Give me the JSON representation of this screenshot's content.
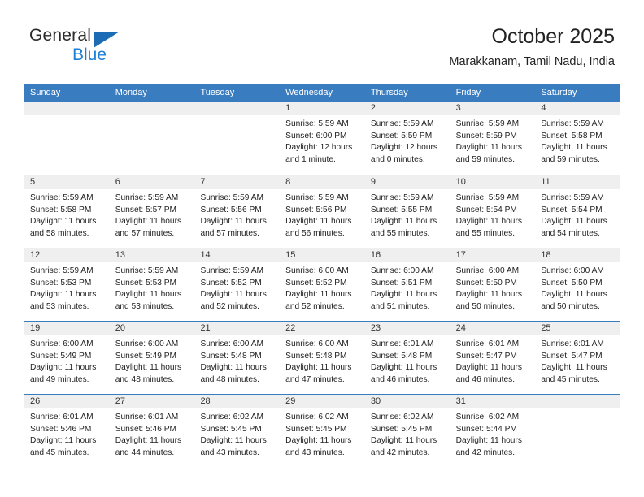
{
  "logo": {
    "top_text": "General",
    "bottom_text": "Blue",
    "triangle_icon": "triangle-icon",
    "accent_dark_blue": "#1b6cb5",
    "accent_blue": "#1f7fd4"
  },
  "header": {
    "title": "October 2025",
    "subtitle": "Marakkanam, Tamil Nadu, India"
  },
  "colors": {
    "header_band": "#3a7cc0",
    "cell_head": "#efefef",
    "text": "#222222"
  },
  "weekdays": [
    "Sunday",
    "Monday",
    "Tuesday",
    "Wednesday",
    "Thursday",
    "Friday",
    "Saturday"
  ],
  "weeks": [
    [
      {
        "day": "",
        "empty": true
      },
      {
        "day": "",
        "empty": true
      },
      {
        "day": "",
        "empty": true
      },
      {
        "day": "1",
        "sunrise": "Sunrise: 5:59 AM",
        "sunset": "Sunset: 6:00 PM",
        "daylight_1": "Daylight: 12 hours",
        "daylight_2": "and 1 minute."
      },
      {
        "day": "2",
        "sunrise": "Sunrise: 5:59 AM",
        "sunset": "Sunset: 5:59 PM",
        "daylight_1": "Daylight: 12 hours",
        "daylight_2": "and 0 minutes."
      },
      {
        "day": "3",
        "sunrise": "Sunrise: 5:59 AM",
        "sunset": "Sunset: 5:59 PM",
        "daylight_1": "Daylight: 11 hours",
        "daylight_2": "and 59 minutes."
      },
      {
        "day": "4",
        "sunrise": "Sunrise: 5:59 AM",
        "sunset": "Sunset: 5:58 PM",
        "daylight_1": "Daylight: 11 hours",
        "daylight_2": "and 59 minutes."
      }
    ],
    [
      {
        "day": "5",
        "sunrise": "Sunrise: 5:59 AM",
        "sunset": "Sunset: 5:58 PM",
        "daylight_1": "Daylight: 11 hours",
        "daylight_2": "and 58 minutes."
      },
      {
        "day": "6",
        "sunrise": "Sunrise: 5:59 AM",
        "sunset": "Sunset: 5:57 PM",
        "daylight_1": "Daylight: 11 hours",
        "daylight_2": "and 57 minutes."
      },
      {
        "day": "7",
        "sunrise": "Sunrise: 5:59 AM",
        "sunset": "Sunset: 5:56 PM",
        "daylight_1": "Daylight: 11 hours",
        "daylight_2": "and 57 minutes."
      },
      {
        "day": "8",
        "sunrise": "Sunrise: 5:59 AM",
        "sunset": "Sunset: 5:56 PM",
        "daylight_1": "Daylight: 11 hours",
        "daylight_2": "and 56 minutes."
      },
      {
        "day": "9",
        "sunrise": "Sunrise: 5:59 AM",
        "sunset": "Sunset: 5:55 PM",
        "daylight_1": "Daylight: 11 hours",
        "daylight_2": "and 55 minutes."
      },
      {
        "day": "10",
        "sunrise": "Sunrise: 5:59 AM",
        "sunset": "Sunset: 5:54 PM",
        "daylight_1": "Daylight: 11 hours",
        "daylight_2": "and 55 minutes."
      },
      {
        "day": "11",
        "sunrise": "Sunrise: 5:59 AM",
        "sunset": "Sunset: 5:54 PM",
        "daylight_1": "Daylight: 11 hours",
        "daylight_2": "and 54 minutes."
      }
    ],
    [
      {
        "day": "12",
        "sunrise": "Sunrise: 5:59 AM",
        "sunset": "Sunset: 5:53 PM",
        "daylight_1": "Daylight: 11 hours",
        "daylight_2": "and 53 minutes."
      },
      {
        "day": "13",
        "sunrise": "Sunrise: 5:59 AM",
        "sunset": "Sunset: 5:53 PM",
        "daylight_1": "Daylight: 11 hours",
        "daylight_2": "and 53 minutes."
      },
      {
        "day": "14",
        "sunrise": "Sunrise: 5:59 AM",
        "sunset": "Sunset: 5:52 PM",
        "daylight_1": "Daylight: 11 hours",
        "daylight_2": "and 52 minutes."
      },
      {
        "day": "15",
        "sunrise": "Sunrise: 6:00 AM",
        "sunset": "Sunset: 5:52 PM",
        "daylight_1": "Daylight: 11 hours",
        "daylight_2": "and 52 minutes."
      },
      {
        "day": "16",
        "sunrise": "Sunrise: 6:00 AM",
        "sunset": "Sunset: 5:51 PM",
        "daylight_1": "Daylight: 11 hours",
        "daylight_2": "and 51 minutes."
      },
      {
        "day": "17",
        "sunrise": "Sunrise: 6:00 AM",
        "sunset": "Sunset: 5:50 PM",
        "daylight_1": "Daylight: 11 hours",
        "daylight_2": "and 50 minutes."
      },
      {
        "day": "18",
        "sunrise": "Sunrise: 6:00 AM",
        "sunset": "Sunset: 5:50 PM",
        "daylight_1": "Daylight: 11 hours",
        "daylight_2": "and 50 minutes."
      }
    ],
    [
      {
        "day": "19",
        "sunrise": "Sunrise: 6:00 AM",
        "sunset": "Sunset: 5:49 PM",
        "daylight_1": "Daylight: 11 hours",
        "daylight_2": "and 49 minutes."
      },
      {
        "day": "20",
        "sunrise": "Sunrise: 6:00 AM",
        "sunset": "Sunset: 5:49 PM",
        "daylight_1": "Daylight: 11 hours",
        "daylight_2": "and 48 minutes."
      },
      {
        "day": "21",
        "sunrise": "Sunrise: 6:00 AM",
        "sunset": "Sunset: 5:48 PM",
        "daylight_1": "Daylight: 11 hours",
        "daylight_2": "and 48 minutes."
      },
      {
        "day": "22",
        "sunrise": "Sunrise: 6:00 AM",
        "sunset": "Sunset: 5:48 PM",
        "daylight_1": "Daylight: 11 hours",
        "daylight_2": "and 47 minutes."
      },
      {
        "day": "23",
        "sunrise": "Sunrise: 6:01 AM",
        "sunset": "Sunset: 5:48 PM",
        "daylight_1": "Daylight: 11 hours",
        "daylight_2": "and 46 minutes."
      },
      {
        "day": "24",
        "sunrise": "Sunrise: 6:01 AM",
        "sunset": "Sunset: 5:47 PM",
        "daylight_1": "Daylight: 11 hours",
        "daylight_2": "and 46 minutes."
      },
      {
        "day": "25",
        "sunrise": "Sunrise: 6:01 AM",
        "sunset": "Sunset: 5:47 PM",
        "daylight_1": "Daylight: 11 hours",
        "daylight_2": "and 45 minutes."
      }
    ],
    [
      {
        "day": "26",
        "sunrise": "Sunrise: 6:01 AM",
        "sunset": "Sunset: 5:46 PM",
        "daylight_1": "Daylight: 11 hours",
        "daylight_2": "and 45 minutes."
      },
      {
        "day": "27",
        "sunrise": "Sunrise: 6:01 AM",
        "sunset": "Sunset: 5:46 PM",
        "daylight_1": "Daylight: 11 hours",
        "daylight_2": "and 44 minutes."
      },
      {
        "day": "28",
        "sunrise": "Sunrise: 6:02 AM",
        "sunset": "Sunset: 5:45 PM",
        "daylight_1": "Daylight: 11 hours",
        "daylight_2": "and 43 minutes."
      },
      {
        "day": "29",
        "sunrise": "Sunrise: 6:02 AM",
        "sunset": "Sunset: 5:45 PM",
        "daylight_1": "Daylight: 11 hours",
        "daylight_2": "and 43 minutes."
      },
      {
        "day": "30",
        "sunrise": "Sunrise: 6:02 AM",
        "sunset": "Sunset: 5:45 PM",
        "daylight_1": "Daylight: 11 hours",
        "daylight_2": "and 42 minutes."
      },
      {
        "day": "31",
        "sunrise": "Sunrise: 6:02 AM",
        "sunset": "Sunset: 5:44 PM",
        "daylight_1": "Daylight: 11 hours",
        "daylight_2": "and 42 minutes."
      },
      {
        "day": "",
        "empty": true
      }
    ]
  ]
}
